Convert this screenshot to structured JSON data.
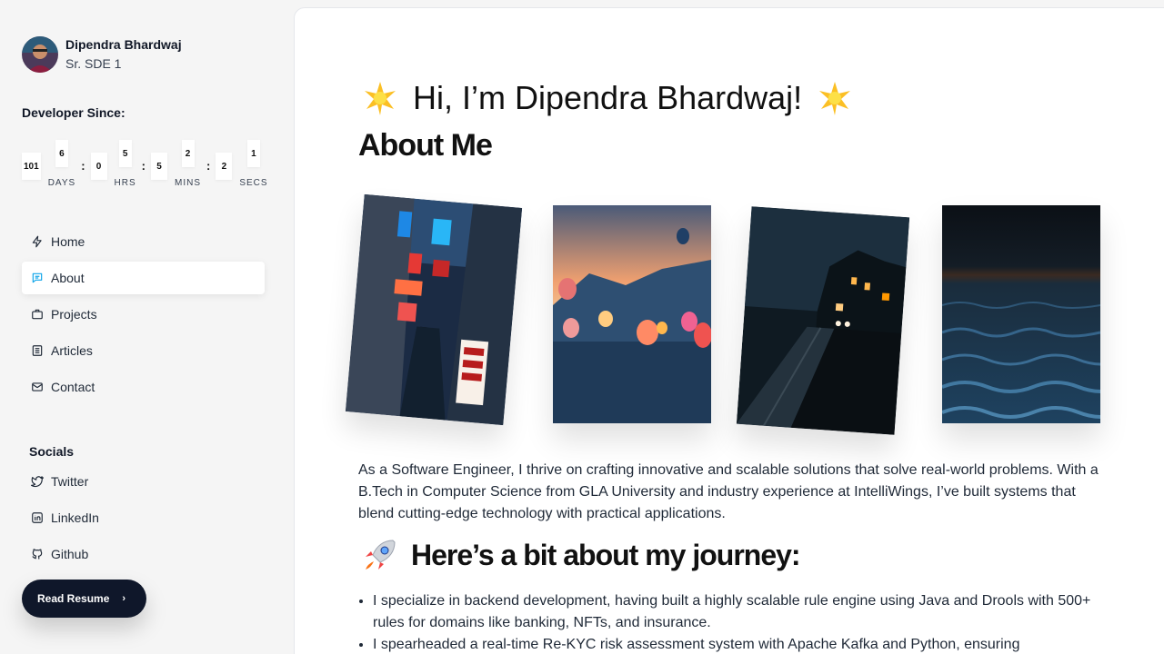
{
  "profile": {
    "name": "Dipendra Bhardwaj",
    "role": "Sr. SDE 1"
  },
  "developer_since": {
    "title": "Developer Since:",
    "days": "101",
    "days_small": "6",
    "days_label": "DAYS",
    "hrs": "0",
    "hrs_small": "5",
    "hrs_label": "HRS",
    "mins": "5",
    "mins_small": "2",
    "mins_label": "MINS",
    "secs": "2",
    "secs_small": "1",
    "secs_label": "SECS",
    "separator": ":"
  },
  "nav": {
    "items": [
      {
        "label": "Home",
        "icon": "bolt-icon"
      },
      {
        "label": "About",
        "icon": "chat-icon",
        "active": true
      },
      {
        "label": "Projects",
        "icon": "briefcase-icon"
      },
      {
        "label": "Articles",
        "icon": "document-icon"
      },
      {
        "label": "Contact",
        "icon": "mail-icon"
      }
    ]
  },
  "socials": {
    "title": "Socials",
    "items": [
      {
        "label": "Twitter",
        "icon": "twitter-icon"
      },
      {
        "label": "LinkedIn",
        "icon": "linkedin-icon"
      },
      {
        "label": "Github",
        "icon": "github-icon"
      }
    ]
  },
  "resume": {
    "label": "Read Resume",
    "chevron": "›"
  },
  "main": {
    "greeting": "Hi, I’m Dipendra Bhardwaj!",
    "about_title": "About Me",
    "intro": "As a Software Engineer, I thrive on crafting innovative and scalable solutions that solve real-world problems. With a B.Tech in Computer Science from GLA University and industry experience at IntelliWings, I’ve built systems that blend cutting-edge technology with practical applications.",
    "journey_title": "Here’s a bit about my journey:",
    "bullets": [
      "I specialize in backend development, having built a highly scalable rule engine using Java and Drools with 500+ rules for domains like banking, NFTs, and insurance.",
      "I spearheaded a real-time Re-KYC risk assessment system with Apache Kafka and Python, ensuring"
    ]
  },
  "colors": {
    "accent": "#0ea5e9",
    "dark": "#0f172a",
    "sparkle": "#fbbf24"
  }
}
